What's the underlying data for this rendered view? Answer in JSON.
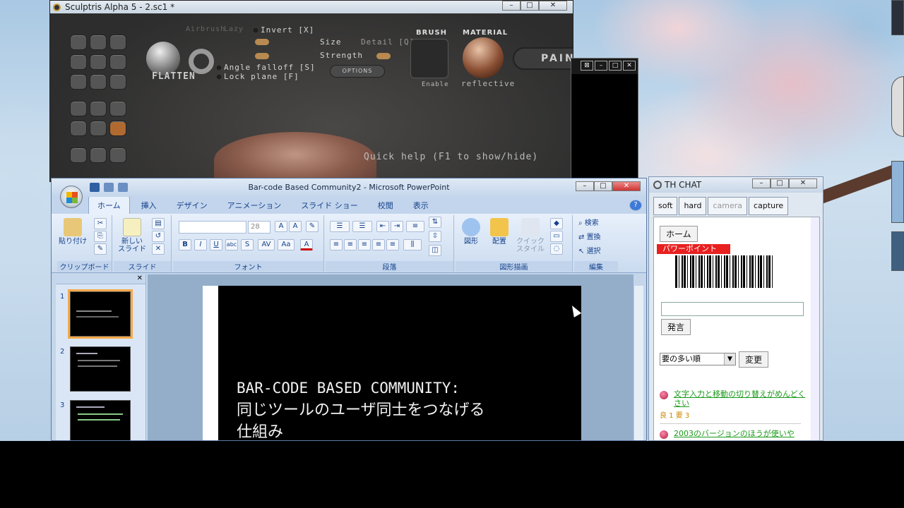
{
  "sculptris": {
    "title": "Sculptris Alpha 5 - 2.sc1 *",
    "tool_name": "FLATTEN",
    "airbrush_label": "Airbrush",
    "lazy_label": "Lazy",
    "invert_label": "Invert [X]",
    "size_label": "Size",
    "detail_label": "Detail [Q]",
    "strength_label": "Strength",
    "angle_falloff_label": "Angle falloff [S]",
    "lock_plane_label": "Lock plane [F]",
    "options_label": "OPTIONS",
    "brush_label": "BRUSH",
    "enable_label": "Enable",
    "material_label": "MATERIAL",
    "material_name": "reflective",
    "paint_label": "PAINT",
    "quick_help": "Quick help (F1 to show/hide)"
  },
  "window_controls": {
    "minimize": "–",
    "maximize": "□",
    "close": "✕"
  },
  "powerpoint": {
    "title": "Bar-code Based Community2 - Microsoft PowerPoint",
    "tabs": [
      "ホーム",
      "挿入",
      "デザイン",
      "アニメーション",
      "スライド ショー",
      "校閲",
      "表示"
    ],
    "active_tab": "ホーム",
    "groups": {
      "clipboard": "クリップボード",
      "slides": "スライド",
      "font": "フォント",
      "paragraph": "段落",
      "drawing": "図形描画",
      "editing": "編集"
    },
    "buttons": {
      "paste": "貼り付け",
      "new_slide_1": "新しい",
      "new_slide_2": "スライド",
      "shapes": "図形",
      "arrange": "配置",
      "quick_style_1": "クイック",
      "quick_style_2": "スタイル",
      "find": "検索",
      "replace": "置換",
      "select": "選択"
    },
    "font_size": "28",
    "format_buttons": [
      "B",
      "I",
      "U",
      "abc",
      "S",
      "AV",
      "Aa",
      "A"
    ],
    "thumbnails": [
      "1",
      "2",
      "3"
    ],
    "slide": {
      "line1": "BAR-CODE BASED COMMUNITY:",
      "line2": "同じツールのユーザ同士をつなげる",
      "line3": "仕組み"
    }
  },
  "chat": {
    "title": "TH CHAT",
    "tabs": [
      "soft",
      "hard",
      "camera",
      "capture"
    ],
    "home_button": "ホーム",
    "tag_label": "パワーポイント",
    "send_button": "発言",
    "sort_option": "要の多い順",
    "change_button": "変更",
    "posts": [
      {
        "text": "文字入力と移動の切り替えがめんどくさい",
        "meta": "良 1 要 3"
      },
      {
        "text": "2003のバージョンのほうが使いや",
        "meta": ""
      }
    ]
  }
}
